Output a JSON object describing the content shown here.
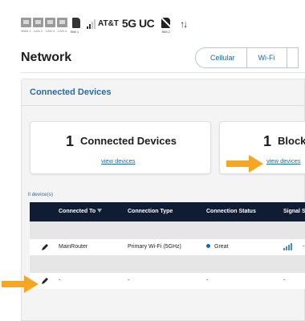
{
  "status_bar": {
    "ports": [
      "WAN 1",
      "LAN 2",
      "LAN 3",
      "LAN 4"
    ],
    "sim1_label": "SIM 1",
    "carrier": "AT&T",
    "network_type": "5G UC",
    "sim2_label": "SIM 2",
    "data_arrows": "↑↓"
  },
  "header": {
    "title": "Network",
    "tabs": [
      "Cellular",
      "Wi-Fi",
      ""
    ]
  },
  "panel": {
    "title": "Connected Devices",
    "cards": [
      {
        "count": "1",
        "label": "Connected Devices",
        "link": "view devices"
      },
      {
        "count": "1",
        "label": "Block",
        "link": "view devices"
      }
    ],
    "device_count": "ll device(s)"
  },
  "table": {
    "columns": [
      "Connected To",
      "Connection Type",
      "Connection Status",
      "Signal S"
    ],
    "rows": [
      {
        "connected_to": "MainRouter",
        "connection_type": "Primary Wi-Fi (5GHz)",
        "status": "Great",
        "status_color": "#1565c0",
        "extra": "-",
        "signal_bars": 4
      },
      {
        "connected_to": "-",
        "connection_type": "-",
        "status": "-",
        "extra": "-"
      }
    ]
  },
  "colors": {
    "accent": "#1f6aa5",
    "table_header": "#0f1c33",
    "arrow": "#f5a623",
    "signal": "#3f8fd8"
  }
}
